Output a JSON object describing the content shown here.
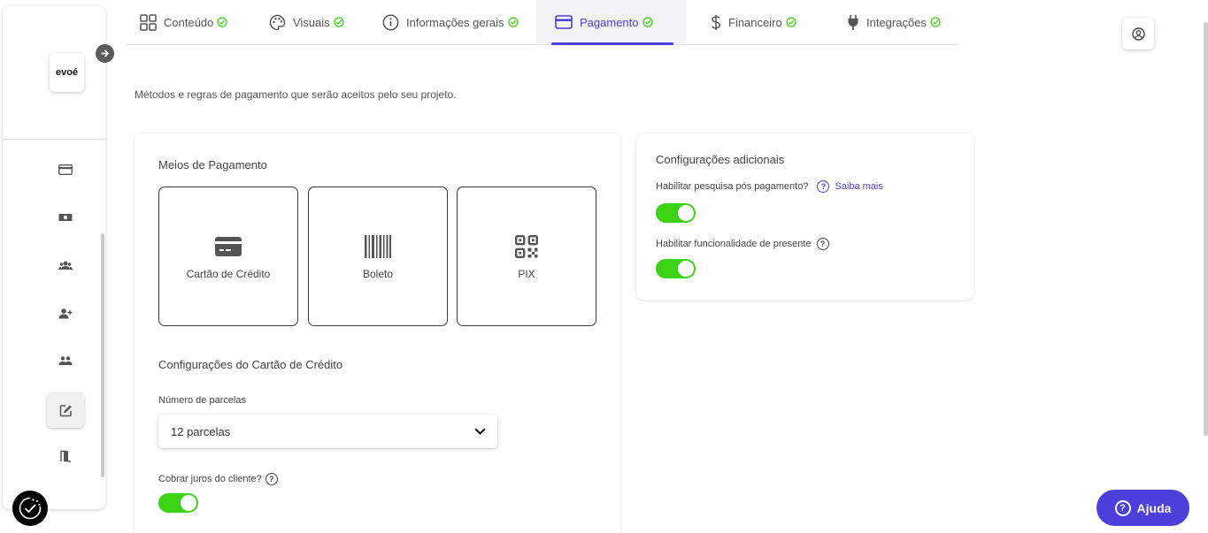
{
  "sidebar": {
    "logo_text": "evoé",
    "items": [
      {
        "icon": "credit-card-icon",
        "active": false
      },
      {
        "icon": "money-icon",
        "active": false
      },
      {
        "icon": "users-icon",
        "active": false
      },
      {
        "icon": "user-add-icon",
        "active": false
      },
      {
        "icon": "group-icon",
        "active": false
      },
      {
        "icon": "edit-icon",
        "active": true
      },
      {
        "icon": "exit-door-icon",
        "active": false
      }
    ]
  },
  "tabs": [
    {
      "label": "Conteúdo",
      "icon": "grid-icon",
      "done": true
    },
    {
      "label": "Visuais",
      "icon": "palette-icon",
      "done": true
    },
    {
      "label": "Informações gerais",
      "icon": "info-icon",
      "done": true
    },
    {
      "label": "Pagamento",
      "icon": "credit-card-icon",
      "done": true,
      "active": true
    },
    {
      "label": "Financeiro",
      "icon": "dollar-icon",
      "done": true
    },
    {
      "label": "Integrações",
      "icon": "plug-icon",
      "done": true
    }
  ],
  "page": {
    "subtitle": "Métodos e regras de pagamento que serão aceitos pelo seu projeto."
  },
  "payment": {
    "section_title": "Meios de Pagamento",
    "methods": [
      {
        "label": "Cartão de Crédito",
        "icon": "credit-card-icon"
      },
      {
        "label": "Boleto",
        "icon": "barcode-icon"
      },
      {
        "label": "PIX",
        "icon": "qr-code-icon"
      }
    ],
    "card_settings_title": "Configurações do Cartão de Crédito",
    "installments_label": "Número de parcelas",
    "installments_value": "12 parcelas",
    "interest_label": "Cobrar juros do cliente?",
    "interest_enabled": true
  },
  "additional": {
    "title": "Configurações adicionais",
    "survey_label": "Habilitar pesquisa pós pagamento?",
    "survey_link": "Saiba mais",
    "survey_enabled": true,
    "gift_label": "Habilitar funcionalidade de presente",
    "gift_enabled": true
  },
  "help_button": {
    "label": "Ajuda"
  },
  "colors": {
    "accent": "#4c3fdb",
    "toggle_on": "#3bd313",
    "check": "#3bd313"
  }
}
